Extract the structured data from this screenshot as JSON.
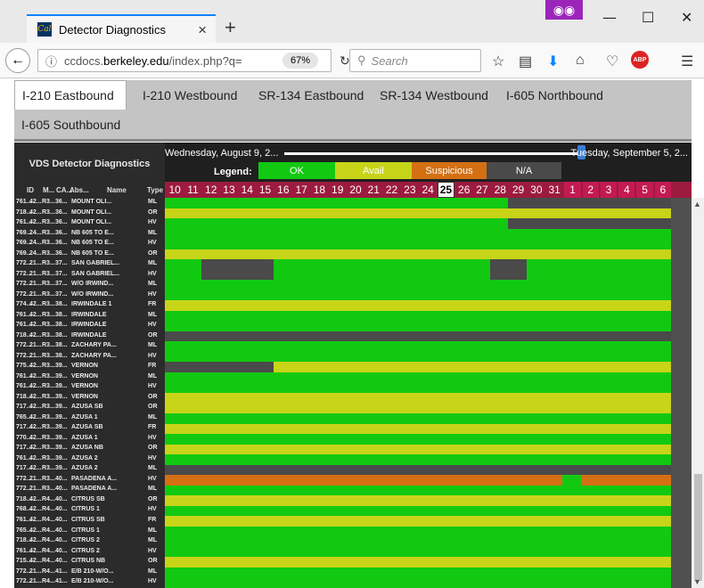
{
  "browser": {
    "tab_title": "Detector Diagnostics",
    "favicon_text": "Cal",
    "url_prefix": "ccdocs.",
    "url_domain": "berkeley.edu",
    "url_path": "/index.php?q=",
    "zoom": "67%",
    "search_placeholder": "Search",
    "new_tab": "+",
    "tab_close": "×",
    "minimize": "—",
    "maximize": "☐",
    "close": "✕"
  },
  "app_tabs": [
    "I-210 Eastbound",
    "I-210 Westbound",
    "SR-134 Eastbound",
    "SR-134 Westbound",
    "I-605 Northbound",
    "I-605 Southbound"
  ],
  "panel": {
    "title": "VDS Detector Diagnostics",
    "columns": [
      "ID",
      "M...",
      "CA...",
      "Abs...",
      "Name",
      "Type"
    ]
  },
  "header": {
    "date_start": "Wednesday, August 9, 2...",
    "date_end": "Tuesday, September 5, 2...",
    "legend_label": "Legend:",
    "legend": [
      {
        "label": "OK",
        "color": "#12c912"
      },
      {
        "label": "Avail",
        "color": "#c8d418"
      },
      {
        "label": "Suspicious",
        "color": "#d47013"
      },
      {
        "label": "N/A",
        "color": "#4a4a4a"
      }
    ]
  },
  "days": [
    "10",
    "11",
    "12",
    "13",
    "14",
    "15",
    "16",
    "17",
    "18",
    "19",
    "20",
    "21",
    "22",
    "23",
    "24",
    "25",
    "26",
    "27",
    "28",
    "29",
    "30",
    "31",
    "1",
    "2",
    "3",
    "4",
    "5",
    "6"
  ],
  "today": "25",
  "colors": {
    "ok": "#12c912",
    "avail": "#c8d418",
    "susp": "#d47013",
    "na": "#4a4a4a"
  },
  "detectors": [
    {
      "id": "761...",
      "m": "42...",
      "ca": "R3...",
      "abs": "36...",
      "name": "MOUNT OLI...",
      "type": "ML",
      "status": [
        [
          "ok",
          0,
          19
        ],
        [
          "na",
          19,
          28
        ]
      ]
    },
    {
      "id": "718...",
      "m": "42...",
      "ca": "R3...",
      "abs": "36...",
      "name": "MOUNT OLI...",
      "type": "OR",
      "status": [
        [
          "avail",
          0,
          28
        ]
      ]
    },
    {
      "id": "761...",
      "m": "42...",
      "ca": "R3...",
      "abs": "36...",
      "name": "MOUNT OLI...",
      "type": "HV",
      "status": [
        [
          "ok",
          0,
          19
        ],
        [
          "na",
          19,
          28
        ]
      ]
    },
    {
      "id": "769...",
      "m": "24...",
      "ca": "R3...",
      "abs": "36...",
      "name": "NB 605 TO E...",
      "type": "ML",
      "status": [
        [
          "ok",
          0,
          28
        ]
      ]
    },
    {
      "id": "769...",
      "m": "24...",
      "ca": "R3...",
      "abs": "36...",
      "name": "NB 605 TO E...",
      "type": "HV",
      "status": [
        [
          "ok",
          0,
          28
        ]
      ]
    },
    {
      "id": "769...",
      "m": "24...",
      "ca": "R3...",
      "abs": "36...",
      "name": "NB 605 TO E...",
      "type": "OR",
      "status": [
        [
          "avail",
          0,
          28
        ]
      ]
    },
    {
      "id": "772...",
      "m": "21...",
      "ca": "R3...",
      "abs": "37...",
      "name": "SAN GABRIEL...",
      "type": "ML",
      "status": [
        [
          "ok",
          0,
          2
        ],
        [
          "na",
          2,
          6
        ],
        [
          "ok",
          6,
          18
        ],
        [
          "na",
          18,
          20
        ],
        [
          "ok",
          20,
          28
        ]
      ]
    },
    {
      "id": "772...",
      "m": "21...",
      "ca": "R3...",
      "abs": "37...",
      "name": "SAN GABRIEL...",
      "type": "HV",
      "status": [
        [
          "ok",
          0,
          2
        ],
        [
          "na",
          2,
          6
        ],
        [
          "ok",
          6,
          18
        ],
        [
          "na",
          18,
          20
        ],
        [
          "ok",
          20,
          28
        ]
      ]
    },
    {
      "id": "772...",
      "m": "21...",
      "ca": "R3...",
      "abs": "37...",
      "name": "W/O IRWIND...",
      "type": "ML",
      "status": [
        [
          "ok",
          0,
          28
        ]
      ]
    },
    {
      "id": "772...",
      "m": "21...",
      "ca": "R3...",
      "abs": "37...",
      "name": "W/O IRWIND...",
      "type": "HV",
      "status": [
        [
          "ok",
          0,
          28
        ]
      ]
    },
    {
      "id": "774...",
      "m": "42...",
      "ca": "R3...",
      "abs": "38...",
      "name": "IRWINDALE 1",
      "type": "FR",
      "status": [
        [
          "avail",
          0,
          28
        ]
      ]
    },
    {
      "id": "761...",
      "m": "42...",
      "ca": "R3...",
      "abs": "38...",
      "name": "IRWINDALE",
      "type": "ML",
      "status": [
        [
          "ok",
          0,
          28
        ]
      ]
    },
    {
      "id": "761...",
      "m": "42...",
      "ca": "R3...",
      "abs": "38...",
      "name": "IRWINDALE",
      "type": "HV",
      "status": [
        [
          "ok",
          0,
          28
        ]
      ]
    },
    {
      "id": "718...",
      "m": "42...",
      "ca": "R3...",
      "abs": "38...",
      "name": "IRWINDALE",
      "type": "OR",
      "status": [
        [
          "na",
          0,
          28
        ]
      ]
    },
    {
      "id": "772...",
      "m": "21...",
      "ca": "R3...",
      "abs": "38...",
      "name": "ZACHARY PA...",
      "type": "ML",
      "status": [
        [
          "ok",
          0,
          28
        ]
      ]
    },
    {
      "id": "772...",
      "m": "21...",
      "ca": "R3...",
      "abs": "38...",
      "name": "ZACHARY PA...",
      "type": "HV",
      "status": [
        [
          "ok",
          0,
          28
        ]
      ]
    },
    {
      "id": "775...",
      "m": "42...",
      "ca": "R3...",
      "abs": "39...",
      "name": "VERNON",
      "type": "FR",
      "status": [
        [
          "na",
          0,
          6
        ],
        [
          "avail",
          6,
          28
        ]
      ]
    },
    {
      "id": "761...",
      "m": "42...",
      "ca": "R3...",
      "abs": "39...",
      "name": "VERNON",
      "type": "ML",
      "status": [
        [
          "ok",
          0,
          28
        ]
      ]
    },
    {
      "id": "761...",
      "m": "42...",
      "ca": "R3...",
      "abs": "39...",
      "name": "VERNON",
      "type": "HV",
      "status": [
        [
          "ok",
          0,
          28
        ]
      ]
    },
    {
      "id": "718...",
      "m": "42...",
      "ca": "R3...",
      "abs": "39...",
      "name": "VERNON",
      "type": "OR",
      "status": [
        [
          "avail",
          0,
          28
        ]
      ]
    },
    {
      "id": "717...",
      "m": "42...",
      "ca": "R3...",
      "abs": "39...",
      "name": "AZUSA SB",
      "type": "OR",
      "status": [
        [
          "avail",
          0,
          28
        ]
      ]
    },
    {
      "id": "765...",
      "m": "42...",
      "ca": "R3...",
      "abs": "39...",
      "name": "AZUSA 1",
      "type": "ML",
      "status": [
        [
          "ok",
          0,
          28
        ]
      ]
    },
    {
      "id": "717...",
      "m": "42...",
      "ca": "R3...",
      "abs": "39...",
      "name": "AZUSA SB",
      "type": "FR",
      "status": [
        [
          "avail",
          0,
          28
        ]
      ]
    },
    {
      "id": "770...",
      "m": "42...",
      "ca": "R3...",
      "abs": "39...",
      "name": "AZUSA 1",
      "type": "HV",
      "status": [
        [
          "ok",
          0,
          28
        ]
      ]
    },
    {
      "id": "717...",
      "m": "42...",
      "ca": "R3...",
      "abs": "39...",
      "name": "AZUSA NB",
      "type": "OR",
      "status": [
        [
          "avail",
          0,
          28
        ]
      ]
    },
    {
      "id": "761...",
      "m": "42...",
      "ca": "R3...",
      "abs": "39...",
      "name": "AZUSA 2",
      "type": "HV",
      "status": [
        [
          "ok",
          0,
          28
        ]
      ]
    },
    {
      "id": "717...",
      "m": "42...",
      "ca": "R3...",
      "abs": "39...",
      "name": "AZUSA 2",
      "type": "ML",
      "status": [
        [
          "na",
          0,
          28
        ]
      ]
    },
    {
      "id": "772...",
      "m": "21...",
      "ca": "R3...",
      "abs": "40...",
      "name": "PASADENA A...",
      "type": "HV",
      "status": [
        [
          "susp",
          0,
          22
        ],
        [
          "ok",
          22,
          23
        ],
        [
          "susp",
          23,
          28
        ]
      ]
    },
    {
      "id": "772...",
      "m": "21...",
      "ca": "R3...",
      "abs": "40...",
      "name": "PASADENA A...",
      "type": "ML",
      "status": [
        [
          "ok",
          0,
          28
        ]
      ]
    },
    {
      "id": "718...",
      "m": "42...",
      "ca": "R4...",
      "abs": "40...",
      "name": "CITRUS SB",
      "type": "OR",
      "status": [
        [
          "avail",
          0,
          28
        ]
      ]
    },
    {
      "id": "768...",
      "m": "42...",
      "ca": "R4...",
      "abs": "40...",
      "name": "CITRUS 1",
      "type": "HV",
      "status": [
        [
          "ok",
          0,
          28
        ]
      ]
    },
    {
      "id": "761...",
      "m": "42...",
      "ca": "R4...",
      "abs": "40...",
      "name": "CITRUS SB",
      "type": "FR",
      "status": [
        [
          "avail",
          0,
          28
        ]
      ]
    },
    {
      "id": "765...",
      "m": "42...",
      "ca": "R4...",
      "abs": "40...",
      "name": "CITRUS 1",
      "type": "ML",
      "status": [
        [
          "ok",
          0,
          28
        ]
      ]
    },
    {
      "id": "718...",
      "m": "42...",
      "ca": "R4...",
      "abs": "40...",
      "name": "CITRUS 2",
      "type": "ML",
      "status": [
        [
          "ok",
          0,
          28
        ]
      ]
    },
    {
      "id": "761...",
      "m": "42...",
      "ca": "R4...",
      "abs": "40...",
      "name": "CITRUS 2",
      "type": "HV",
      "status": [
        [
          "ok",
          0,
          28
        ]
      ]
    },
    {
      "id": "715...",
      "m": "42...",
      "ca": "R4...",
      "abs": "40...",
      "name": "CITRUS NB",
      "type": "OR",
      "status": [
        [
          "avail",
          0,
          28
        ]
      ]
    },
    {
      "id": "772...",
      "m": "21...",
      "ca": "R4...",
      "abs": "41...",
      "name": "E/B 210-W/O...",
      "type": "ML",
      "status": [
        [
          "ok",
          0,
          28
        ]
      ]
    },
    {
      "id": "772...",
      "m": "21...",
      "ca": "R4...",
      "abs": "41...",
      "name": "E/B 210-W/O...",
      "type": "HV",
      "status": [
        [
          "ok",
          0,
          28
        ]
      ]
    }
  ]
}
